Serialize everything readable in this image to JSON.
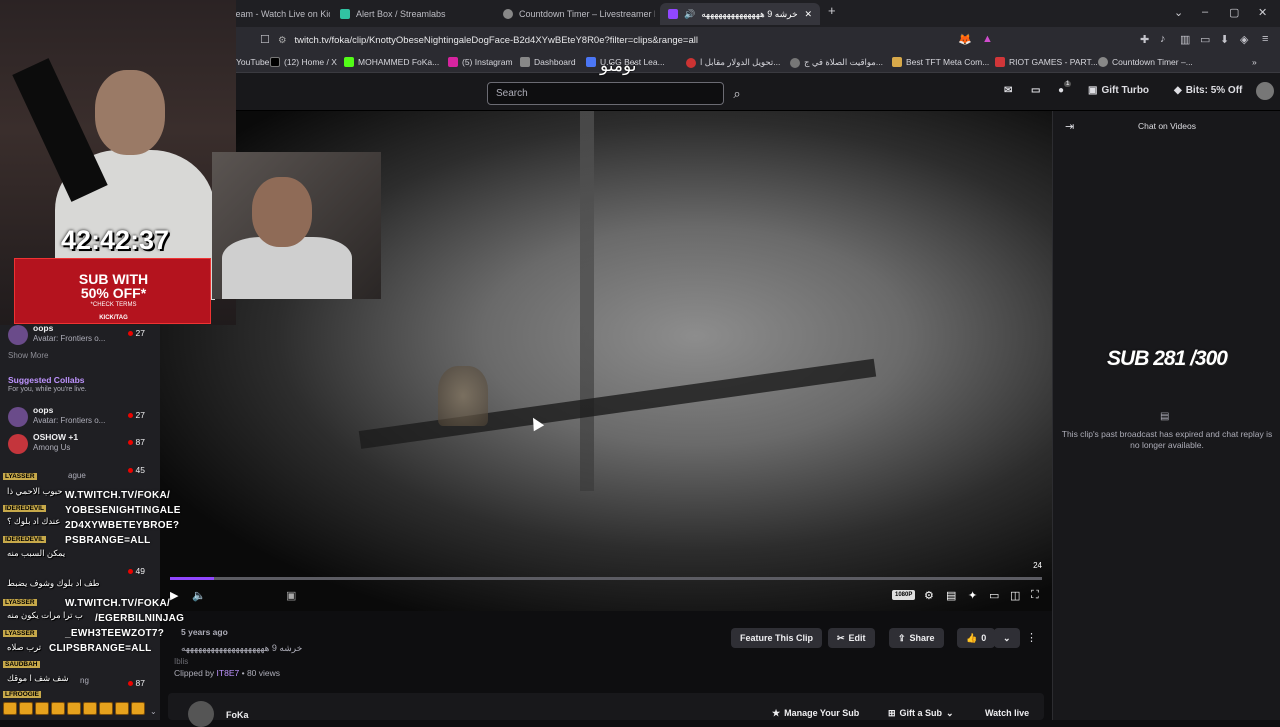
{
  "browser": {
    "tabs": [
      {
        "label": "Stream - Watch Live on Kick",
        "active": false
      },
      {
        "label": "Alert Box / Streamlabs",
        "active": false
      },
      {
        "label": "Countdown Timer – Livestreamer Hu",
        "active": false
      },
      {
        "label": "خرشه 9 ههههههههههههههه",
        "active": true
      }
    ],
    "url": "twitch.tv/foka/clip/KnottyObeseNightingaleDogFace-B2d4XYwBEteY8R0e?filter=clips&range=all",
    "bookmarks": [
      {
        "label": "YouTube"
      },
      {
        "label": "(12) Home / X"
      },
      {
        "label": "MOHAMMED FoKa..."
      },
      {
        "label": "(5) Instagram"
      },
      {
        "label": "Dashboard"
      },
      {
        "label": "U.GG Best Lea..."
      },
      {
        "label": "تحويل الدولار مقابل ا..."
      },
      {
        "label": "مواقيت الصلاة في ج..."
      },
      {
        "label": "Best TFT Meta Com..."
      },
      {
        "label": "RIOT GAMES - PART..."
      },
      {
        "label": "Countdown Timer –..."
      }
    ]
  },
  "topnav": {
    "search_placeholder": "Search",
    "gift_turbo": "Gift Turbo",
    "bits": "Bits: 5% Off",
    "notification_count": "1"
  },
  "sidebar": {
    "show_more": "Show More",
    "suggested_title": "Suggested Collabs",
    "suggested_subtitle": "For you, while you're live.",
    "channels_top": [
      {
        "name": "oops",
        "game": "Avatar: Frontiers o...",
        "viewers": "27"
      }
    ],
    "channels_suggested": [
      {
        "name": "oops",
        "game": "Avatar: Frontiers o...",
        "viewers": "27"
      },
      {
        "name": "OSHOW +1",
        "game": "Among Us",
        "viewers": "87"
      },
      {
        "name": "",
        "game": "ague",
        "viewers": "45"
      },
      {
        "name": "",
        "game": "",
        "viewers": "49"
      },
      {
        "name": "",
        "game": "ng",
        "viewers": "87"
      }
    ]
  },
  "player": {
    "clip_duration": "24",
    "quality": "1080P",
    "progress": 0.05
  },
  "clip": {
    "age": "5 years ago",
    "title": "خرشه 9 ههههههههههههههههههههه",
    "category": "Iblis",
    "clipped_by": "Clipped by",
    "clipper": "IT8E7",
    "views": "• 80 views",
    "feature": "Feature This Clip",
    "edit": "Edit",
    "share": "Share",
    "likes": "0",
    "channel_name": "FoKa",
    "manage_sub": "Manage Your Sub",
    "gift_sub": "Gift a Sub",
    "watch_live": "Watch live"
  },
  "chat": {
    "title": "Chat on Videos",
    "expired_message": "This clip's past broadcast has expired and chat replay is no longer available."
  },
  "overlay": {
    "timer": "42:42:37",
    "arabic_top": "نومنو",
    "sub_goal": "SUB 281 /300",
    "promo_main_1": "SUB WITH",
    "promo_main_2": "50% OFF*",
    "promo_small": "*CHECK TERMS",
    "promo_brand": "KICK/TAG",
    "chat_lines": [
      {
        "user": "LYASSER",
        "text": "حبوب الاحمي ذا"
      },
      {
        "user": "IDEREDEVIL",
        "text": "عندك اد بلوك ؟"
      },
      {
        "user": "IDEREDEVIL",
        "text": "يمكن السبب منه"
      },
      {
        "user": "",
        "text": "طف اد بلوك وشوف يضبط"
      },
      {
        "user": "LYASSER",
        "text": "ب ترا مرات يكون منه"
      },
      {
        "user": "LYASSER",
        "text": "ترب صلاه"
      },
      {
        "user": "SAUDBAH",
        "text": "شف شف ا موقك"
      },
      {
        "user": "LFROOGIE",
        "text": ""
      }
    ],
    "chat_big_lines": [
      "W.TWITCH.TV/FOKA/",
      "YOBESENIGHTINGALE",
      "2D4XYWBETEYBROE?",
      "PSBRANGE=ALL",
      "W.TWITCH.TV/FOKA/",
      "/EGERBILNINJAG",
      "_EWH3TEEWZOT7?",
      "CLIPSBRANGE=ALL"
    ]
  }
}
